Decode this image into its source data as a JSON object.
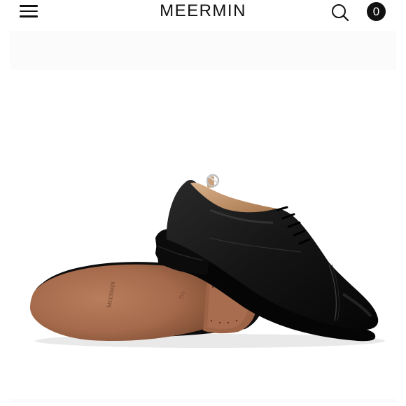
{
  "header": {
    "logo": "MEERMIN",
    "cart_count": "0",
    "menu_icon": "hamburger-menu-icon",
    "search_icon": "search-icon"
  },
  "product": {
    "image": "black-oxford-shoe-pair",
    "sole_imprint": "MEERMIN",
    "sole_size": "7½"
  },
  "colors": {
    "text": "#111111",
    "leather": "#151515",
    "sole": "#a0674a",
    "background": "#ffffff"
  }
}
